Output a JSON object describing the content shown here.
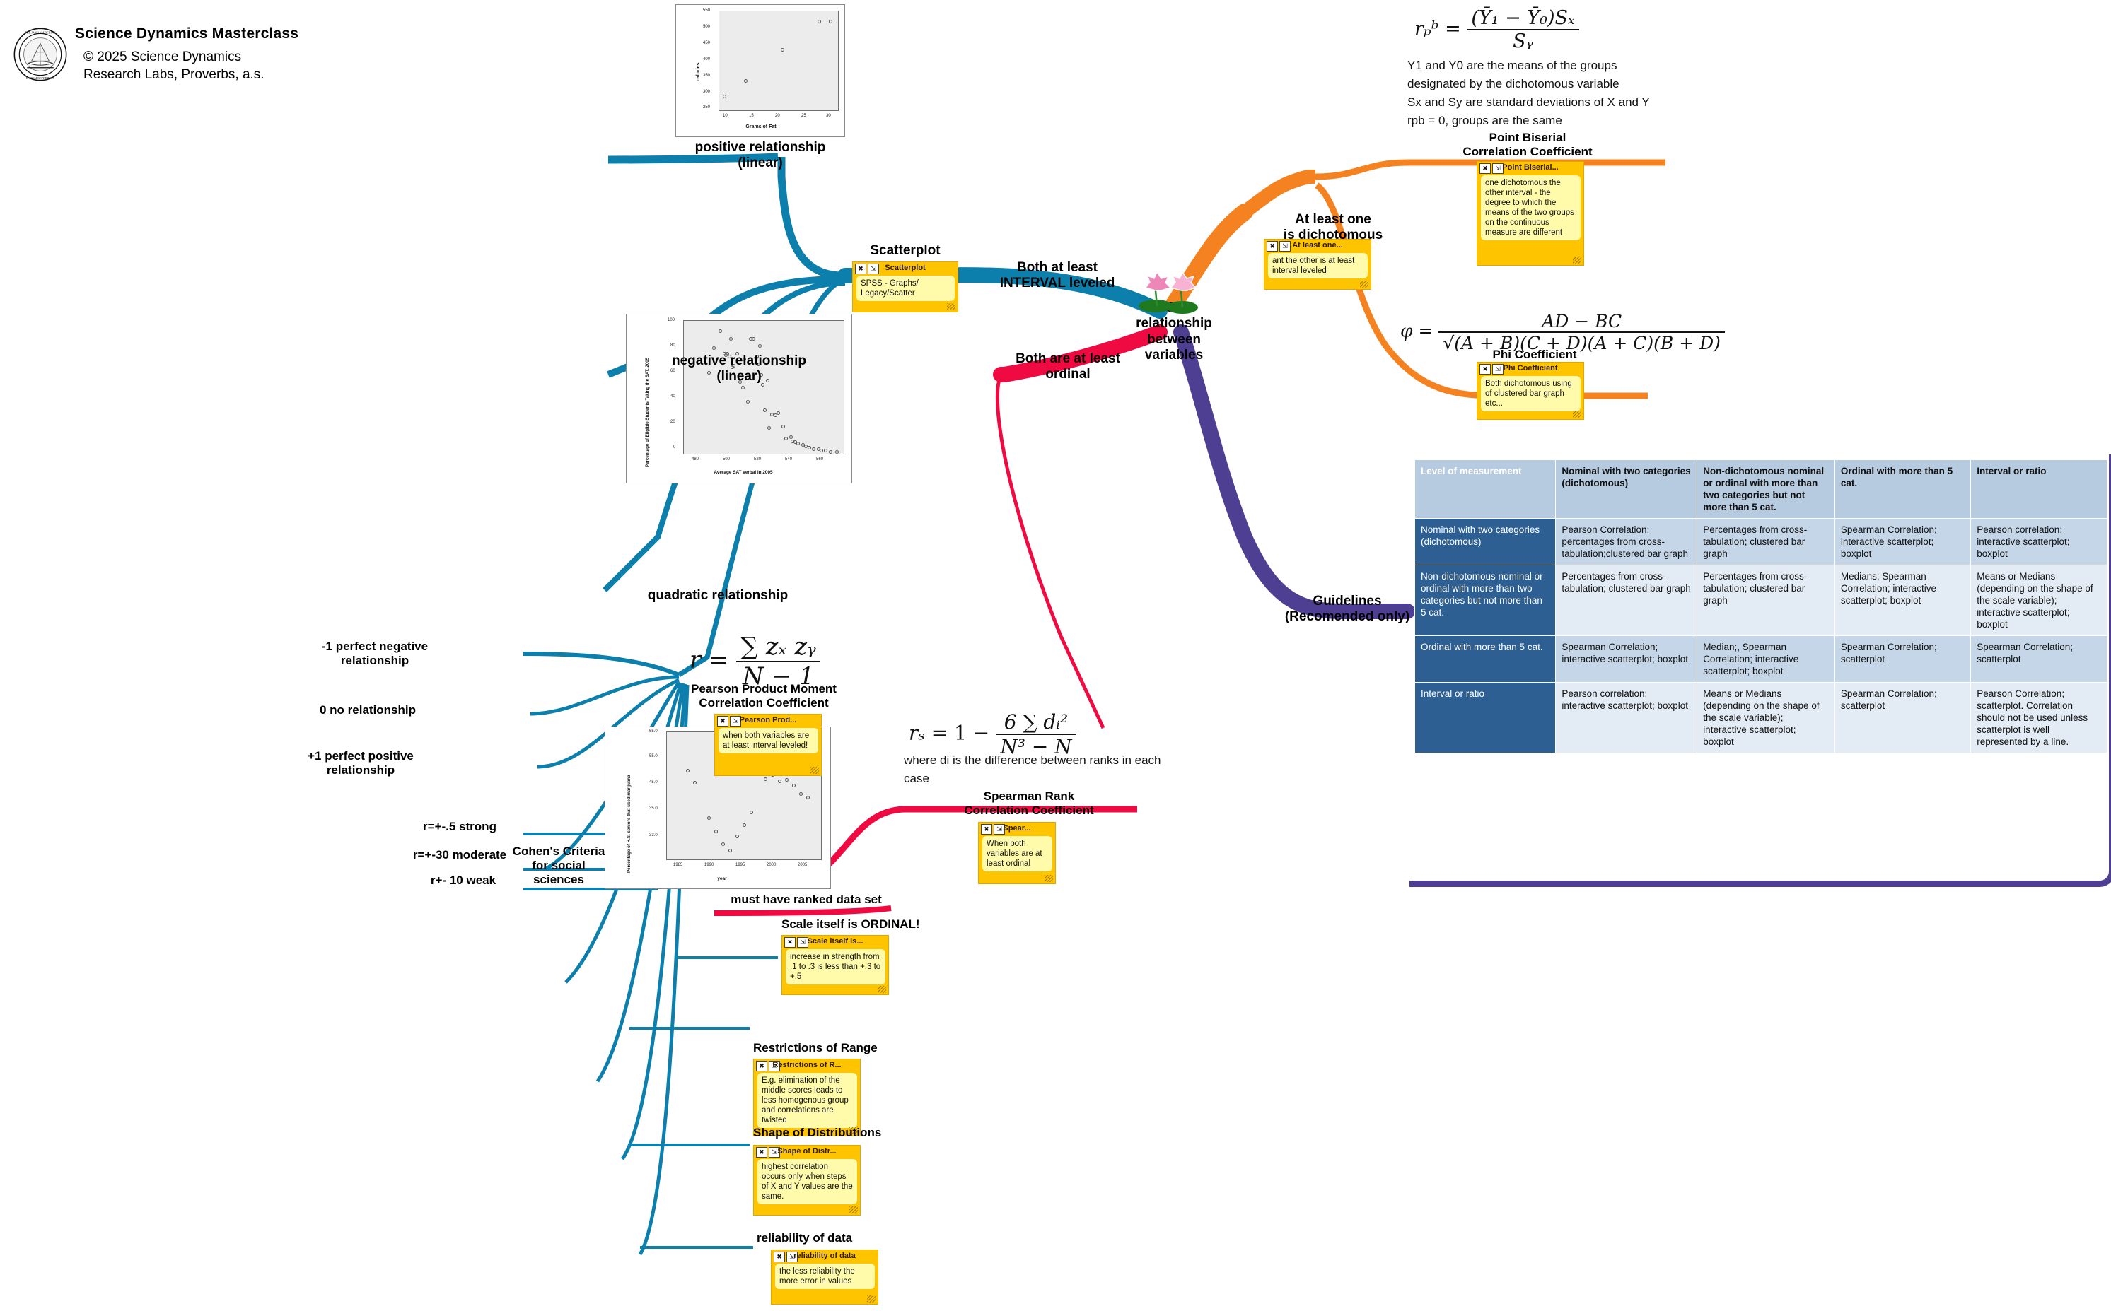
{
  "brand": {
    "title": "Science Dynamics Masterclass",
    "copyright_line1": "© 2025 Science Dynamics",
    "copyright_line2": "Research Labs, Proverbs, a.s.",
    "seal_icon": "academic-seal-icon"
  },
  "center": {
    "label": "5 -\nrelationship\nbetween\nvariables",
    "icon": "lotus-flowers-icon"
  },
  "branches": {
    "interval": {
      "label": "Both at least\nINTERVAL leveled",
      "color": "#0d7fac"
    },
    "ordinal": {
      "label": "Both are at least\nordinal",
      "color": "#ef0b42"
    },
    "dichotomous": {
      "label": "At least one\nis dichotomous",
      "color": "#f58220"
    },
    "guidelines": {
      "label": "Guidelines\n(Recomended only)",
      "color": "#4f3f92"
    }
  },
  "scatterplots": [
    {
      "caption": "positive relationship\n(linear)",
      "ylabel": "calories",
      "xlabel": "Grams of Fat",
      "yticks": [
        "550",
        "500",
        "450",
        "400",
        "350",
        "300",
        "250"
      ],
      "xticks": [
        "10",
        "15",
        "20",
        "25",
        "30"
      ]
    },
    {
      "caption": "negative relationship\n(linear)",
      "ylabel": "Percentage of Eligible Students Taking the SAT, 2005",
      "xlabel": "Average SAT verbal in 2005",
      "yticks": [
        "100",
        "80",
        "60",
        "40",
        "20",
        "0"
      ],
      "xticks": [
        "480",
        "500",
        "520",
        "540",
        "560"
      ]
    },
    {
      "caption": "quadratic relationship",
      "ylabel": "Percentage of H.S. seniors that used marijuana",
      "xlabel": "year",
      "yticks": [
        "65.0",
        "55.0",
        "45.0",
        "35.0",
        "33.0"
      ],
      "xticks": [
        "1985",
        "1990",
        "1995",
        "2000",
        "2005"
      ]
    }
  ],
  "scatterplot_node": {
    "label": "Scatterplot",
    "note_title": "Scatterplot",
    "note_body": "SPSS - Graphs/ Legacy/Scatter"
  },
  "pearson": {
    "formula_lhs": "r",
    "formula_eq": "=",
    "numerator": "∑ zₓ zᵧ",
    "denominator": "N − 1",
    "title": "Pearson Product Moment\nCorrelation Coefficient",
    "note_title": "Pearson Prod...",
    "note_body": "when both variables are at least interval leveled!",
    "scale_labels": [
      "-1 perfect negative relationship",
      "0 no relationship",
      "+1 perfect positive relationship"
    ],
    "cohen_title": "Cohen's Criteria\nfor social\nsciences",
    "cohen_items": [
      "r=+-.5 strong",
      "r=+-30 moderate",
      "r+- 10 weak"
    ],
    "cautions": [
      {
        "label": "Scale itself is ORDINAL!",
        "note_title": "Scale itself is...",
        "note_body": "increase in strength from .1 to .3 is less than +.3 to +.5"
      },
      {
        "label": "Restrictions of Range",
        "note_title": "Restrictions of R...",
        "note_body": "E.g. elimination of the middle scores leads to less homogenous group and correlations are twisted"
      },
      {
        "label": "Shape of Distributions",
        "note_title": "Shape of Distr...",
        "note_body": "highest correlation occurs only when steps of X and Y values are the same."
      },
      {
        "label": "reliability of data",
        "note_title": "reliability of data",
        "note_body": "the less reliability the more error in values"
      }
    ]
  },
  "spearman": {
    "formula_lhs": "rₛ",
    "formula_mid": "= 1 −",
    "numerator": "6 ∑ dᵢ²",
    "denominator": "N³ − N",
    "explain": "where di is the difference between ranks in each case",
    "title": "Spearman Rank\nCorrelation Coefficient",
    "note_title": "Spear...",
    "note_body": "When both variables are at least ordinal",
    "requirement": "must have ranked data set"
  },
  "point_biserial": {
    "formula_lhs": "rₚᵇ",
    "numerator": "(Ȳ₁ − Ȳ₀)Sₓ",
    "denominator": "Sᵧ",
    "lines": [
      "Y1 and Y0 are the means of the groups",
      "designated by the dichotomous variable",
      "Sx and Sy are standard deviations of X and Y",
      "rpb = 0, groups are the same"
    ],
    "title": "Point Biserial\nCorrelation Coefficient",
    "note_title": "Point Biserial...",
    "note_body": "one dichotomous the other interval - the degree to which the means of the two groups on the continuous measure are different"
  },
  "dichotomous_note": {
    "note_title": "At least one...",
    "note_body": "ant the other is at least interval leveled"
  },
  "phi": {
    "formula_lhs": "φ",
    "numerator": "AD − BC",
    "denominator": "√(A + B)(C + D)(A + C)(B + D)",
    "title": "Phi Coefficient",
    "note_title": "Phi Coefficient",
    "note_body": "Both dichotomous using of clustered bar graph etc..."
  },
  "guidelines_table": {
    "columns": [
      "Level of measurement",
      "Nominal with two categories (dichotomous)",
      "Non-dichotomous nominal or ordinal with more than two categories but not more than 5 cat.",
      "Ordinal with more than 5 cat.",
      "Interval or ratio"
    ],
    "rows": [
      {
        "header": "Nominal with two categories (dichotomous)",
        "cells": [
          "Pearson Correlation; percentages from cross-tabulation;clustered bar graph",
          "Percentages from cross-tabulation; clustered bar graph",
          "Spearman Correlation; interactive scatterplot; boxplot",
          "Pearson correlation; interactive scatterplot; boxplot"
        ]
      },
      {
        "header": "Non-dichotomous nominal or ordinal with more than two categories but not more than 5 cat.",
        "cells": [
          "Percentages from cross-tabulation; clustered bar graph",
          "Percentages from cross-tabulation; clustered bar graph",
          "Medians; Spearman Correlation; interactive scatterplot; boxplot",
          "Means or Medians (depending on the shape of the scale variable); interactive scatterplot; boxplot"
        ]
      },
      {
        "header": "Ordinal with more than 5 cat.",
        "cells": [
          "Spearman Correlation; interactive scatterplot; boxplot",
          "Median;, Spearman Correlation; interactive scatterplot; boxplot",
          "Spearman Correlation; scatterplot",
          "Spearman Correlation; scatterplot"
        ]
      },
      {
        "header": "Interval or ratio",
        "cells": [
          "Pearson correlation; interactive scatterplot; boxplot",
          "Means or Medians (depending on the shape of the scale variable); interactive scatterplot; boxplot",
          "Spearman Correlation; scatterplot",
          "Pearson Correlation; scatterplot. Correlation should not be used unless scatterplot is well represented by a line."
        ]
      }
    ]
  },
  "chart_data": [
    {
      "type": "scatter",
      "title": "positive relationship (linear)",
      "xlabel": "Grams of Fat",
      "ylabel": "calories",
      "xlim": [
        8,
        32
      ],
      "ylim": [
        240,
        570
      ],
      "grid": false,
      "x": [
        10,
        14,
        21,
        28,
        30
      ],
      "y": [
        268,
        318,
        432,
        530,
        530
      ]
    },
    {
      "type": "scatter",
      "title": "negative relationship (linear)",
      "xlabel": "Average SAT verbal in 2005",
      "ylabel": "Percentage of Eligible Students Taking the SAT, 2005",
      "xlim": [
        470,
        575
      ],
      "ylim": [
        0,
        100
      ],
      "grid": false,
      "x": [
        490,
        487,
        494,
        497,
        498,
        499,
        500,
        501,
        502,
        503,
        505,
        507,
        509,
        510,
        512,
        514,
        516,
        518,
        519,
        520,
        521,
        522,
        523,
        525,
        526,
        528,
        530,
        532,
        535,
        537,
        540,
        541,
        543,
        545,
        548,
        550,
        552,
        555,
        558,
        560,
        563,
        566,
        570
      ],
      "y": [
        79,
        61,
        92,
        75,
        74,
        75,
        73,
        86,
        65,
        66,
        75,
        54,
        50,
        71,
        39,
        86,
        86,
        73,
        67,
        81,
        59,
        52,
        33,
        55,
        20,
        30,
        29,
        31,
        21,
        12,
        13,
        10,
        9,
        8,
        7,
        6,
        5,
        4,
        4,
        3,
        3,
        2,
        2
      ]
    },
    {
      "type": "scatter",
      "title": "quadratic relationship",
      "xlabel": "year",
      "ylabel": "Percentage of H.S. seniors that used marijuana",
      "xlim": [
        1984,
        2006
      ],
      "ylim": [
        33,
        65
      ],
      "grid": false,
      "x": [
        1987,
        1988,
        1990,
        1991,
        1992,
        1993,
        1994,
        1995,
        1996,
        1998,
        1999,
        2000,
        2001,
        2002,
        2003,
        2004
      ],
      "y": [
        55.2,
        52.2,
        43.4,
        40.1,
        37.0,
        35.3,
        38.9,
        41.7,
        44.9,
        53.1,
        54.2,
        52.6,
        52.9,
        51.5,
        49.4,
        48.6
      ]
    }
  ]
}
